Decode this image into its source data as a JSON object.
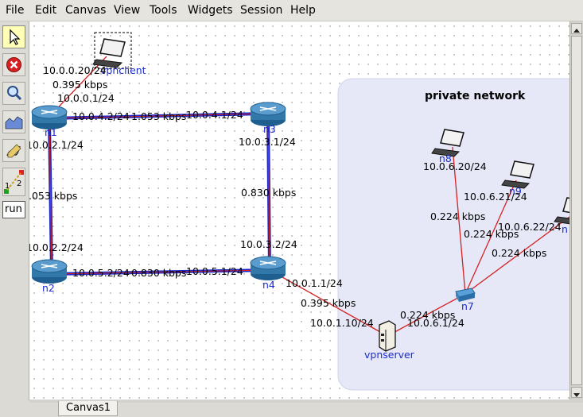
{
  "menu": [
    "File",
    "Edit",
    "Canvas",
    "View",
    "Tools",
    "Widgets",
    "Session",
    "Help"
  ],
  "tools": {
    "run_label": "run",
    "marker_label_1": "1",
    "marker_label_2": "2"
  },
  "network": {
    "private_title": "private network",
    "nodes": {
      "vpnclient": "vpnclient",
      "n1": "n1",
      "n2": "n2",
      "n3": "n3",
      "n4": "n4",
      "n7": "n7",
      "n8": "n8",
      "n9": "n9",
      "n10": "n",
      "vpnserver": "vpnserver"
    },
    "labels": {
      "client_ip": "10.0.0.20/24",
      "client_bw": "0.395 kbps",
      "n1_ip0": "10.0.0.1/24",
      "n1_ip4": "10.0.4.2/24",
      "n1_n3_bw": "1.053 kbps",
      "n3_ip4": "10.0.4.1/24",
      "n1_ip2": "10.0.2.1/24",
      "n1_n2_bw": ".053 kbps",
      "n2_ip2": "10.0.2.2/24",
      "n3_ip3": "10.0.3.1/24",
      "n3_n4_bw": "0.830 kbps",
      "n4_ip3": "10.0.3.2/24",
      "n2_ip5": "10.0.5.2/24",
      "n2_n4_bw": "0.830 kbps",
      "n4_ip5": "10.0.5.1/24",
      "n4_ip1": "10.0.1.1/24",
      "n4_srv_bw": "0.395 kbps",
      "srv_ip1": "10.0.1.10/24",
      "srv_n7_bw": "0.224 kbps",
      "srv_ip6": "10.0.6.1/24",
      "n8_ip": "10.0.6.20/24",
      "n8_bw": "0.224 kbps",
      "n9_ip": "10.0.6.21/24",
      "n9_bw": "0.224 kbps",
      "n10_ip": "10.0.6.22/24",
      "n10_bw": "0.224 kbps"
    }
  },
  "tabs": {
    "canvas1": "Canvas1"
  },
  "colors": {
    "link_blue": "#1e28c8",
    "link_red": "#d42020",
    "private_bg": "#e6e8f8"
  }
}
